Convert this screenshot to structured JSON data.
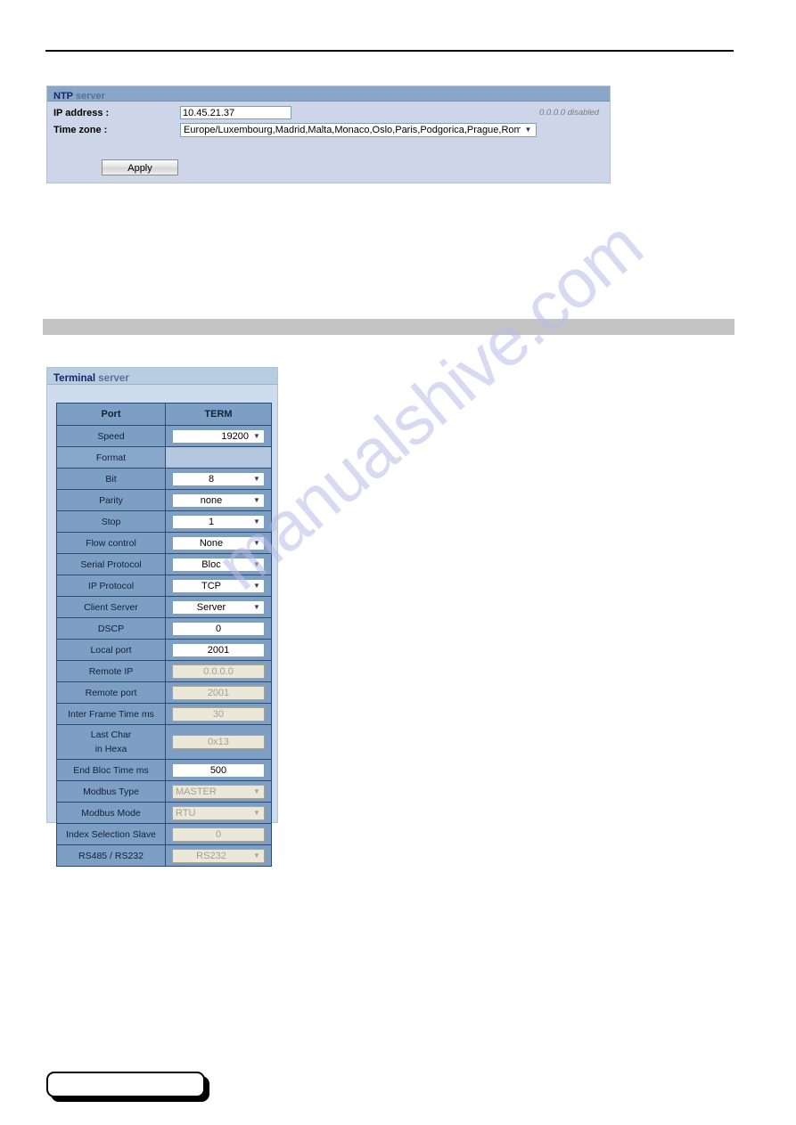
{
  "page": {
    "watermark": "manualshive.com"
  },
  "ntp_panel": {
    "title_bold": "NTP",
    "title_light": " server",
    "ip_label": "IP address :",
    "ip_value": "10.45.21.37",
    "ip_hint": "0.0.0.0 disabled",
    "timezone_label": "Time zone :",
    "timezone_value": "Europe/Luxembourg,Madrid,Malta,Monaco,Oslo,Paris,Podgorica,Prague,Rome,S",
    "apply_label": "Apply",
    "arrow": "▼"
  },
  "terminal_panel": {
    "title_bold": "Terminal",
    "title_light": " server",
    "arrow": "▼",
    "header": {
      "col_port": "Port",
      "col_term": "TERM"
    },
    "rows": [
      {
        "label": "Speed",
        "value": "19200",
        "type": "select",
        "align": "right",
        "disabled": false
      },
      {
        "label": "Format",
        "value": "",
        "type": "none",
        "align": "center",
        "disabled": false
      },
      {
        "label": "Bit",
        "value": "8",
        "type": "select",
        "align": "center",
        "disabled": false
      },
      {
        "label": "Parity",
        "value": "none",
        "type": "select",
        "align": "center",
        "disabled": false
      },
      {
        "label": "Stop",
        "value": "1",
        "type": "select",
        "align": "center",
        "disabled": false
      },
      {
        "label": "Flow control",
        "value": "None",
        "type": "select",
        "align": "center",
        "disabled": false
      },
      {
        "label": "Serial Protocol",
        "value": "Bloc",
        "type": "select",
        "align": "center",
        "disabled": false
      },
      {
        "label": "IP Protocol",
        "value": "TCP",
        "type": "select",
        "align": "center",
        "disabled": false
      },
      {
        "label": "Client Server",
        "value": "Server",
        "type": "select",
        "align": "center",
        "disabled": false
      },
      {
        "label": "DSCP",
        "value": "0",
        "type": "text",
        "align": "center",
        "disabled": false
      },
      {
        "label": "Local port",
        "value": "2001",
        "type": "text",
        "align": "center",
        "disabled": false
      },
      {
        "label": "Remote IP",
        "value": "0.0.0.0",
        "type": "text",
        "align": "center",
        "disabled": true
      },
      {
        "label": "Remote port",
        "value": "2001",
        "type": "text",
        "align": "center",
        "disabled": true
      },
      {
        "label": "Inter Frame Time ms",
        "value": "30",
        "type": "text",
        "align": "center",
        "disabled": true
      },
      {
        "label": "Last Char\nin Hexa",
        "value": "0x13",
        "type": "text",
        "align": "center",
        "disabled": true
      },
      {
        "label": "End Bloc Time ms",
        "value": "500",
        "type": "text",
        "align": "center",
        "disabled": false
      },
      {
        "label": "Modbus Type",
        "value": "MASTER",
        "type": "select",
        "align": "left",
        "disabled": true
      },
      {
        "label": "Modbus Mode",
        "value": "RTU",
        "type": "select",
        "align": "left",
        "disabled": true
      },
      {
        "label": "Index Selection Slave",
        "value": "0",
        "type": "text",
        "align": "center",
        "disabled": true
      },
      {
        "label": "RS485 / RS232",
        "value": "RS232",
        "type": "select",
        "align": "center",
        "disabled": true
      }
    ],
    "labels": {
      "last_char_line1": "Last Char",
      "last_char_line2": "in Hexa"
    }
  }
}
